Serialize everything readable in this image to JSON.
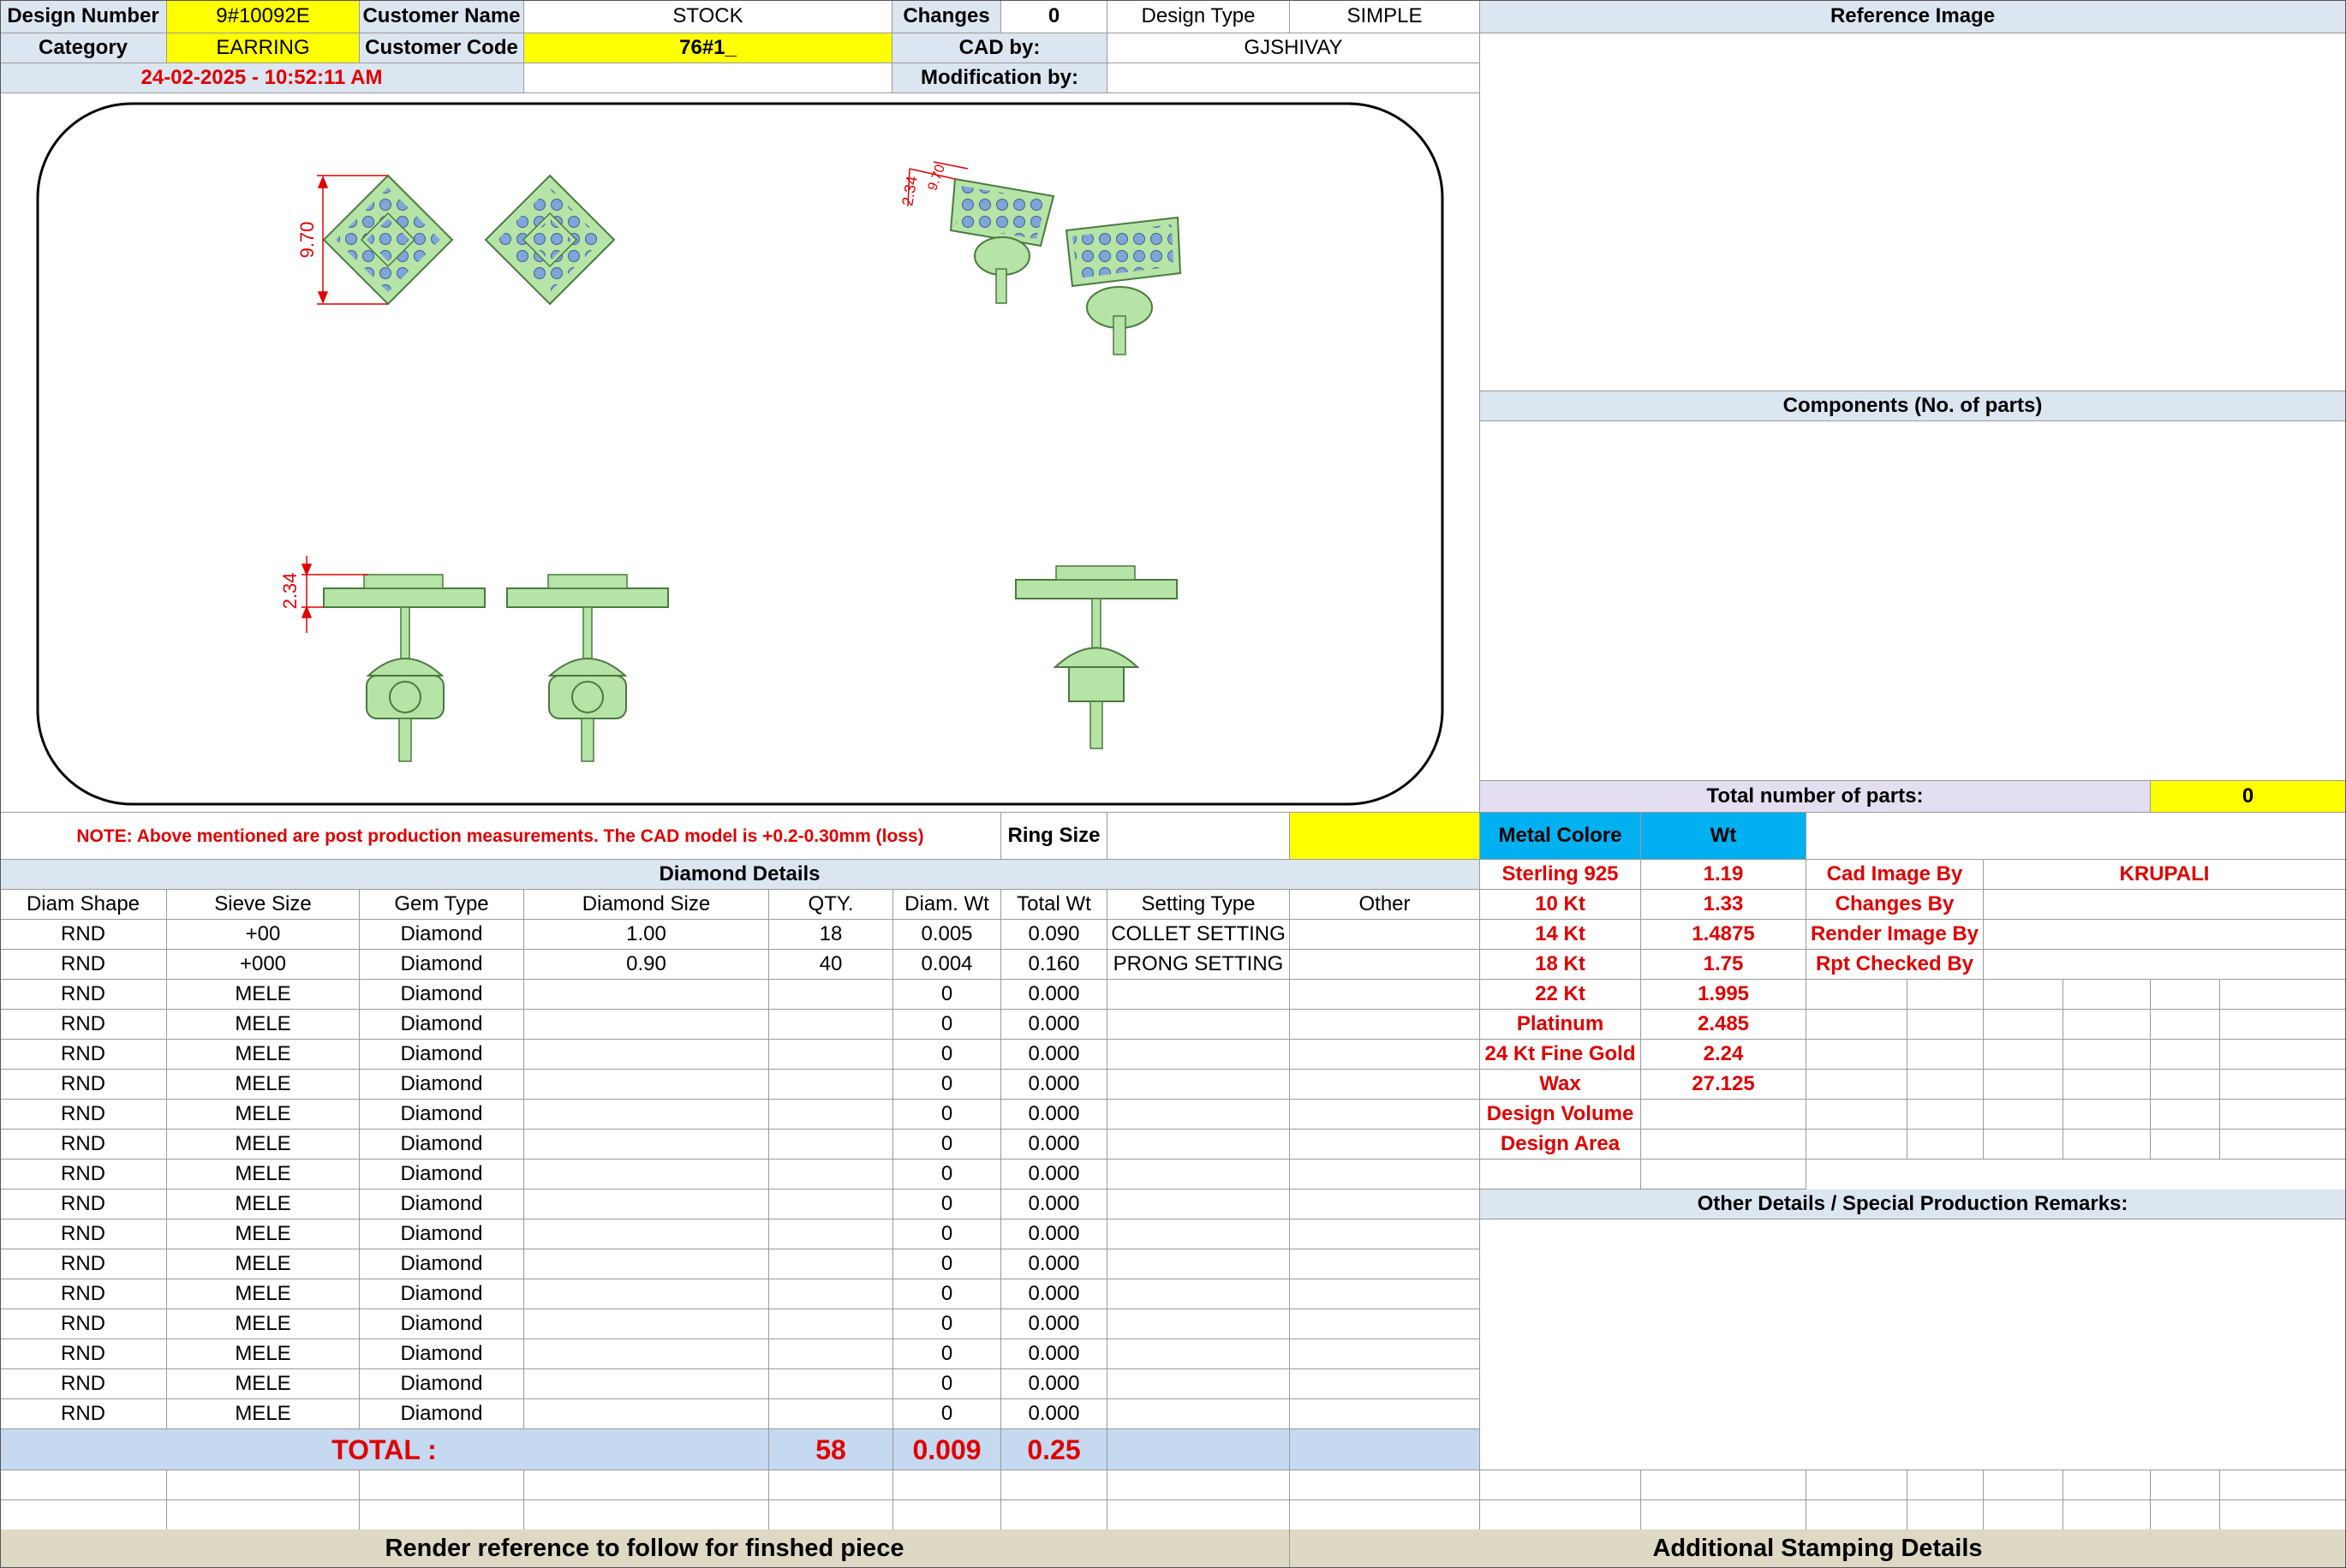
{
  "header": {
    "design_number_label": "Design Number",
    "design_number": "9#10092E",
    "customer_name_label": "Customer Name",
    "customer_name": "STOCK",
    "changes_label": "Changes",
    "changes": "0",
    "design_type_label": "Design Type",
    "design_type": "SIMPLE",
    "category_label": "Category",
    "category": "EARRING",
    "customer_code_label": "Customer Code",
    "customer_code": "76#1_",
    "cad_by_label": "CAD by:",
    "cad_by": "GJSHIVAY",
    "timestamp": "24-02-2025 - 10:52:11 AM",
    "modification_by_label": "Modification by:",
    "modification_by": ""
  },
  "drawing": {
    "dim_top_width": "9.70",
    "dim_side_height": "2.34",
    "dim_persp_a": "2.34",
    "dim_persp_b": "9.70"
  },
  "right_panel": {
    "reference_image_title": "Reference Image",
    "components_title": "Components (No. of parts)",
    "total_parts_label": "Total number of parts:",
    "total_parts": "0"
  },
  "note": "NOTE: Above mentioned are post production measurements. The CAD model is +0.2-0.30mm (loss)",
  "ring_size_label": "Ring Size",
  "ring_size": "",
  "diamond": {
    "title": "Diamond Details",
    "columns": [
      "Diam Shape",
      "Sieve Size",
      "Gem Type",
      "Diamond Size",
      "QTY.",
      "Diam. Wt",
      "Total Wt",
      "Setting Type",
      "Other"
    ],
    "rows": [
      [
        "RND",
        "+00",
        "Diamond",
        "1.00",
        "18",
        "0.005",
        "0.090",
        "COLLET SETTING",
        ""
      ],
      [
        "RND",
        "+000",
        "Diamond",
        "0.90",
        "40",
        "0.004",
        "0.160",
        "PRONG SETTING",
        ""
      ],
      [
        "RND",
        "MELE",
        "Diamond",
        "",
        "",
        "0",
        "0.000",
        "",
        ""
      ],
      [
        "RND",
        "MELE",
        "Diamond",
        "",
        "",
        "0",
        "0.000",
        "",
        ""
      ],
      [
        "RND",
        "MELE",
        "Diamond",
        "",
        "",
        "0",
        "0.000",
        "",
        ""
      ],
      [
        "RND",
        "MELE",
        "Diamond",
        "",
        "",
        "0",
        "0.000",
        "",
        ""
      ],
      [
        "RND",
        "MELE",
        "Diamond",
        "",
        "",
        "0",
        "0.000",
        "",
        ""
      ],
      [
        "RND",
        "MELE",
        "Diamond",
        "",
        "",
        "0",
        "0.000",
        "",
        ""
      ],
      [
        "RND",
        "MELE",
        "Diamond",
        "",
        "",
        "0",
        "0.000",
        "",
        ""
      ],
      [
        "RND",
        "MELE",
        "Diamond",
        "",
        "",
        "0",
        "0.000",
        "",
        ""
      ],
      [
        "RND",
        "MELE",
        "Diamond",
        "",
        "",
        "0",
        "0.000",
        "",
        ""
      ],
      [
        "RND",
        "MELE",
        "Diamond",
        "",
        "",
        "0",
        "0.000",
        "",
        ""
      ],
      [
        "RND",
        "MELE",
        "Diamond",
        "",
        "",
        "0",
        "0.000",
        "",
        ""
      ],
      [
        "RND",
        "MELE",
        "Diamond",
        "",
        "",
        "0",
        "0.000",
        "",
        ""
      ],
      [
        "RND",
        "MELE",
        "Diamond",
        "",
        "",
        "0",
        "0.000",
        "",
        ""
      ],
      [
        "RND",
        "MELE",
        "Diamond",
        "",
        "",
        "0",
        "0.000",
        "",
        ""
      ],
      [
        "RND",
        "MELE",
        "Diamond",
        "",
        "",
        "0",
        "0.000",
        "",
        ""
      ]
    ],
    "total_label": "TOTAL :",
    "total_qty": "58",
    "total_diam_wt": "0.009",
    "total_wt": "0.25"
  },
  "metal": {
    "color_label": "Metal Colore",
    "wt_label": "Wt",
    "rows": [
      [
        "Sterling 925",
        "1.19"
      ],
      [
        "10 Kt",
        "1.33"
      ],
      [
        "14 Kt",
        "1.4875"
      ],
      [
        "18 Kt",
        "1.75"
      ],
      [
        "22 Kt",
        "1.995"
      ],
      [
        "Platinum",
        "2.485"
      ],
      [
        "24 Kt Fine Gold",
        "2.24"
      ],
      [
        "Wax",
        "27.125"
      ],
      [
        "Design Volume",
        ""
      ],
      [
        "Design Area",
        ""
      ]
    ]
  },
  "credits": [
    [
      "Cad Image By",
      "KRUPALI"
    ],
    [
      "Changes By",
      ""
    ],
    [
      "Render Image By",
      ""
    ],
    [
      "Rpt Checked By",
      ""
    ]
  ],
  "other_details_title": "Other Details / Special Production Remarks:",
  "footer": {
    "render_reference": "Render reference to follow for finshed piece",
    "additional_stamping": "Additional Stamping Details"
  },
  "colors": {
    "yellow": "#ffff00",
    "header_blue": "#dce6f1",
    "red_text": "#e00000",
    "tan": "#ddd9c4",
    "metal_blue": "#00b0f0",
    "model_green": "#b6e3a6"
  }
}
